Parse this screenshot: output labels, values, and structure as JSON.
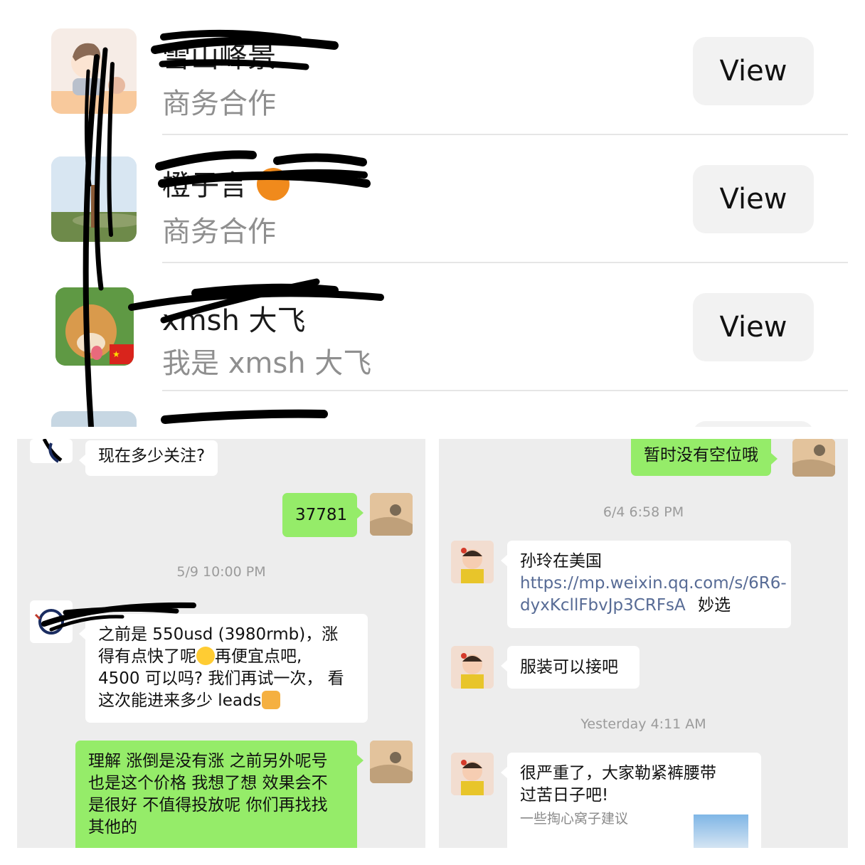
{
  "contacts": [
    {
      "name": "雪山峰景",
      "subtitle": "商务合作",
      "action": "View"
    },
    {
      "name": "橙子言",
      "subtitle": "商务合作",
      "action": "View"
    },
    {
      "name": "xmsh 大飞",
      "subtitle": "我是 xmsh 大飞",
      "action": "View"
    }
  ],
  "chat_left": {
    "msg1": "现在多少关注?",
    "msg2": "37781",
    "timestamp1": "5/9 10:00 PM",
    "msg3_line1": "之前是 550usd (3980rmb)，涨",
    "msg3_line2a": "得有点快了呢",
    "msg3_line2b": "再便宜点吧,",
    "msg3_line3": "4500 可以吗? 我们再试一次， 看",
    "msg3_line4": "这次能进来多少 leads",
    "msg4_line1": "理解 涨倒是没有涨 之前另外呢号",
    "msg4_line2": "也是这个价格 我想了想 效果会不",
    "msg4_line3": "是很好 不值得投放呢 你们再找找",
    "msg4_line4": "其他的"
  },
  "chat_right": {
    "msg1": "暂时没有空位哦",
    "timestamp1": "6/4 6:58 PM",
    "msg2_title": "孙玲在美国",
    "msg2_link_line1": "https://mp.weixin.qq.com/s/6R6-",
    "msg2_link_line2": "dyxKcllFbvJp3CRFsA",
    "msg2_tail": "妙选",
    "msg3": "服装可以接吧",
    "timestamp2": "Yesterday 4:11 AM",
    "msg4_title_line1": "很严重了，大家勒紧裤腰带",
    "msg4_title_line2": "过苦日子吧!",
    "msg4_desc": "一些掏心窝子建议"
  },
  "colors": {
    "bubble_out": "#95ec69",
    "bubble_in": "#ffffff",
    "chat_bg": "#ededed",
    "link": "#576b95"
  }
}
